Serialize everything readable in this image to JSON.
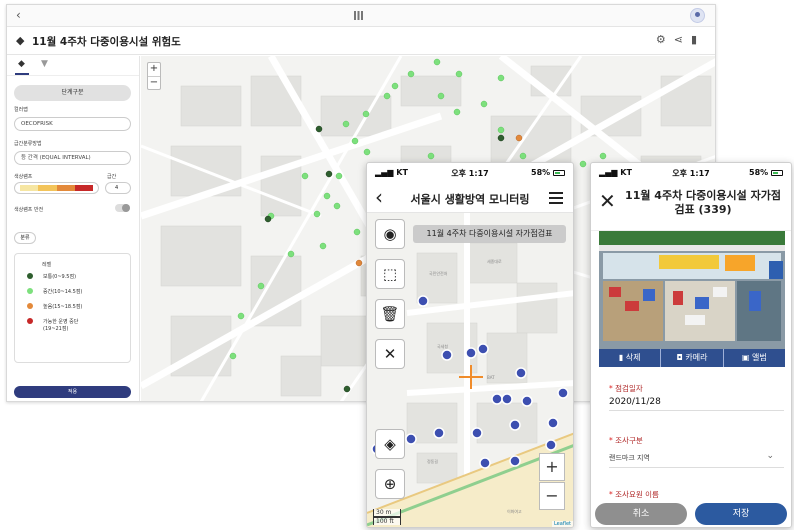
{
  "desktop": {
    "title": "11월 4주차 다중이용시설 위험도",
    "sidebar": {
      "classify_button": "단계구분",
      "color_map_label": "컬러맵",
      "color_map_value": "OECOFRISK",
      "interval_label": "급간분류방법",
      "interval_value": "등 간격 (EQUAL INTERVAL)",
      "ramp_label": "색상램프",
      "class_label": "급간",
      "class_value": "4",
      "reverse_label": "색상램프 반전",
      "classify2_button": "분류",
      "legend_header": "레벨",
      "legend": [
        {
          "label": "보통(0~9.5점)",
          "color": "#2e5e2e"
        },
        {
          "label": "증간(10~14.5점)",
          "color": "#7de07d"
        },
        {
          "label": "높음(15~18.5점)",
          "color": "#e3893a"
        },
        {
          "label": "가능한 운영 중단",
          "label2": "(19~21점)",
          "color": "#c62828"
        }
      ],
      "apply_button": "적용"
    }
  },
  "phone1": {
    "status": {
      "carrier": "KT",
      "time": "오후 1:17",
      "battery": "58%"
    },
    "header_title": "서울시 생활방역 모니터링",
    "tooltip": "11월 4주차 다중이용시설 자가점검표",
    "tools": [
      {
        "icon": "target-icon",
        "glyph": "◉"
      },
      {
        "icon": "select-icon",
        "glyph": "⬚"
      },
      {
        "icon": "trash-icon",
        "glyph": "🗑"
      },
      {
        "icon": "close-icon",
        "glyph": "✕"
      },
      {
        "icon": "layers-icon",
        "glyph": "◈"
      },
      {
        "icon": "locate-icon",
        "glyph": "⊕"
      }
    ],
    "zoom_in": "+",
    "zoom_out": "−",
    "scale_m": "30 m",
    "scale_ft": "100 ft",
    "attribution": "Leaflet"
  },
  "phone2": {
    "status": {
      "carrier": "KT",
      "time": "오후 1:17",
      "battery": "58%"
    },
    "header_title": "11월 4주차 다중이용시설 자가점검표 (339)",
    "actions": [
      "삭제",
      "카메라",
      "앨범"
    ],
    "date_label": "점검일자",
    "date_value": "2020/11/28",
    "type_label": "조사구분",
    "type_value": "랜드마크 지역",
    "inspector_label": "조사요원 이름",
    "cancel_button": "취소",
    "save_button": "저장"
  },
  "colors": {
    "primary": "#2f3c7e",
    "green": "#7de07d",
    "dark_green": "#2e5e2e",
    "orange": "#e3893a",
    "blue_marker": "#3d4fb0"
  }
}
